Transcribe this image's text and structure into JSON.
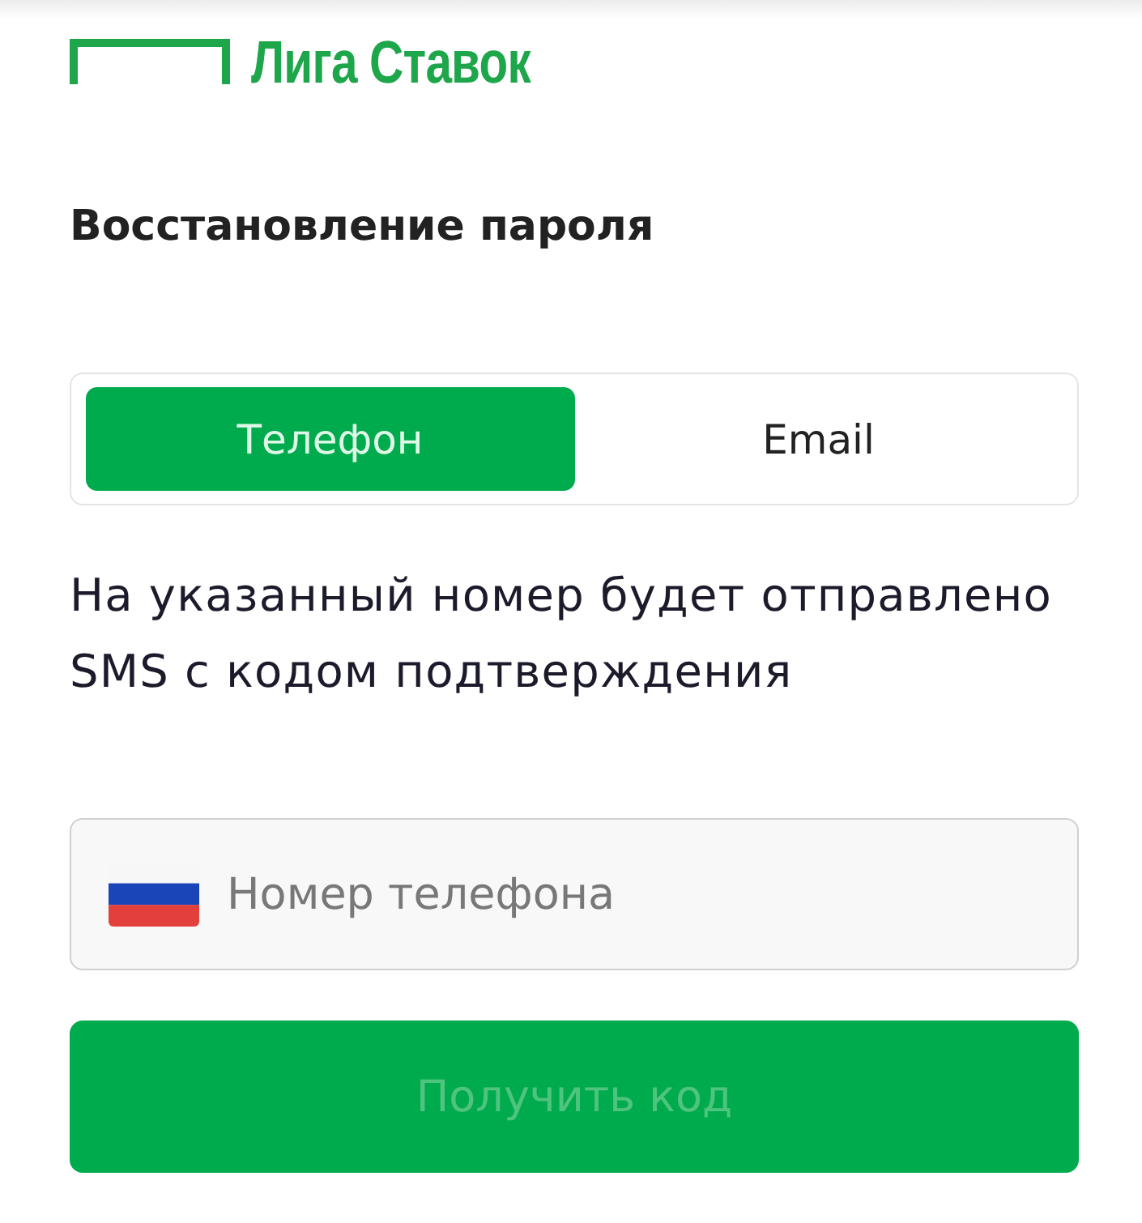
{
  "header": {
    "logo": "Лига Ставок"
  },
  "title": "Восстановление пароля",
  "tabs": [
    {
      "label": "Телефон",
      "selected": true
    },
    {
      "label": "Email",
      "selected": false
    }
  ],
  "hint": "На указанный номер будет отправлено SMS с кодом подтверждения",
  "phone_field": {
    "placeholder": "Номер телефона"
  },
  "submit": {
    "label": "Получить код",
    "disabled": true
  }
}
